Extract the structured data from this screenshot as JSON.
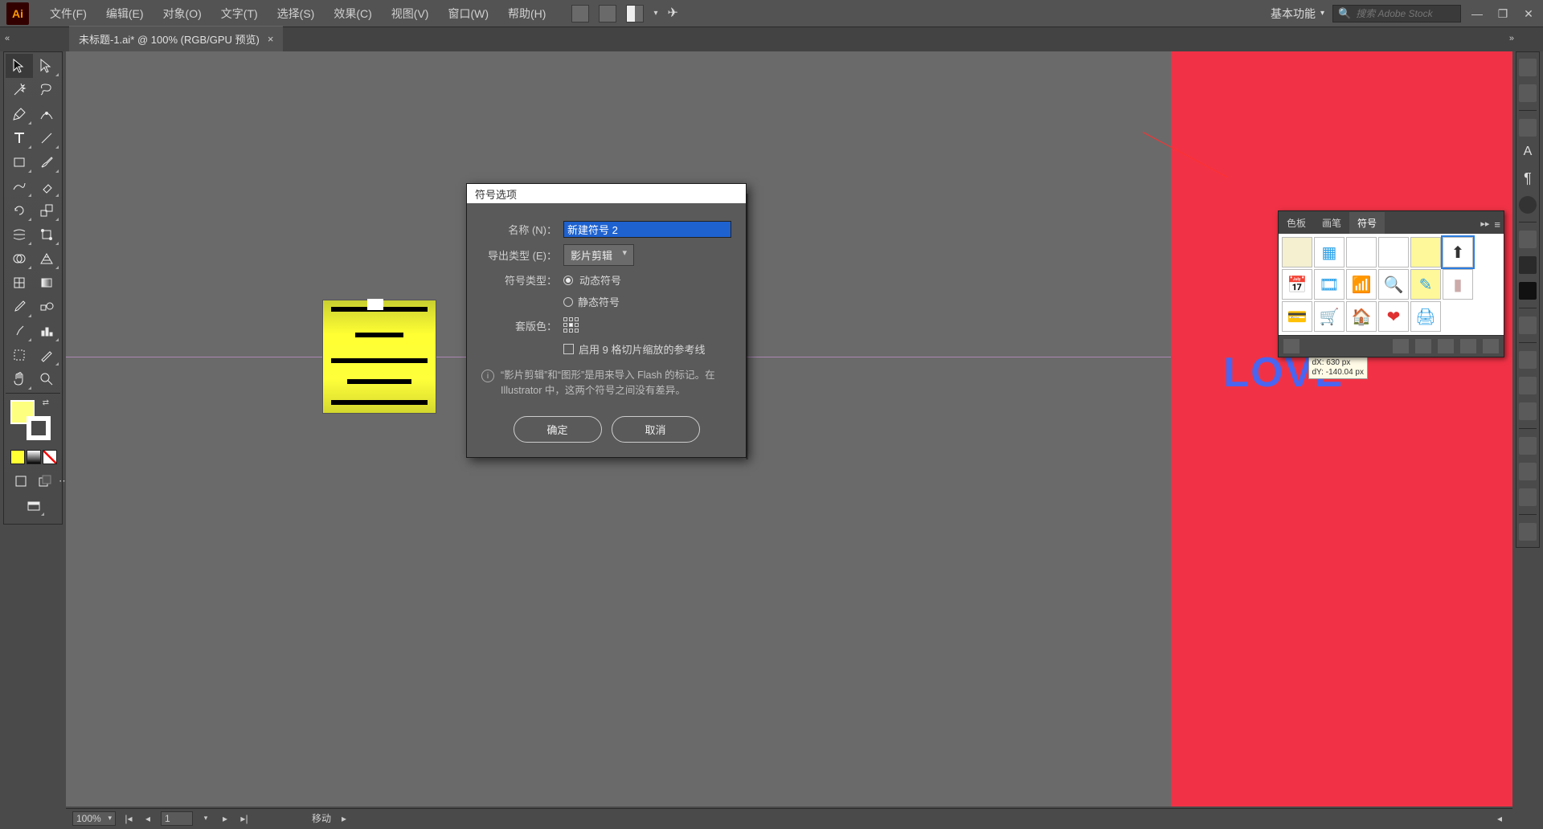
{
  "app_logo": "Ai",
  "menu": {
    "file": "文件(F)",
    "edit": "编辑(E)",
    "object": "对象(O)",
    "type": "文字(T)",
    "select": "选择(S)",
    "effect": "效果(C)",
    "view": "视图(V)",
    "window": "窗口(W)",
    "help": "帮助(H)"
  },
  "workspace_label": "基本功能",
  "search_placeholder": "搜索 Adobe Stock",
  "document_tab": "未标题-1.ai* @ 100% (RGB/GPU 预览)",
  "dialog": {
    "title": "符号选项",
    "name_label": "名称 (N)：",
    "name_value": "新建符号 2",
    "export_type_label": "导出类型 (E)：",
    "export_type_value": "影片剪辑",
    "symbol_type_label": "符号类型：",
    "radio_dynamic": "动态符号",
    "radio_static": "静态符号",
    "registration_label": "套版色：",
    "checkbox_label": "启用 9 格切片缩放的参考线",
    "info_text": "“影片剪辑”和“图形”是用来导入 Flash 的标记。在 Illustrator 中，这两个符号之间没有差异。",
    "ok": "确定",
    "cancel": "取消"
  },
  "symbols_panel": {
    "tabs": {
      "swatches": "色板",
      "brushes": "画笔",
      "symbols": "符号"
    }
  },
  "canvas": {
    "love_text": "LOVE",
    "tooltip_line1": "dX: 630 px",
    "tooltip_line2": "dY: -140.04 px"
  },
  "status": {
    "zoom": "100%",
    "page": "1",
    "mode": "移动"
  }
}
